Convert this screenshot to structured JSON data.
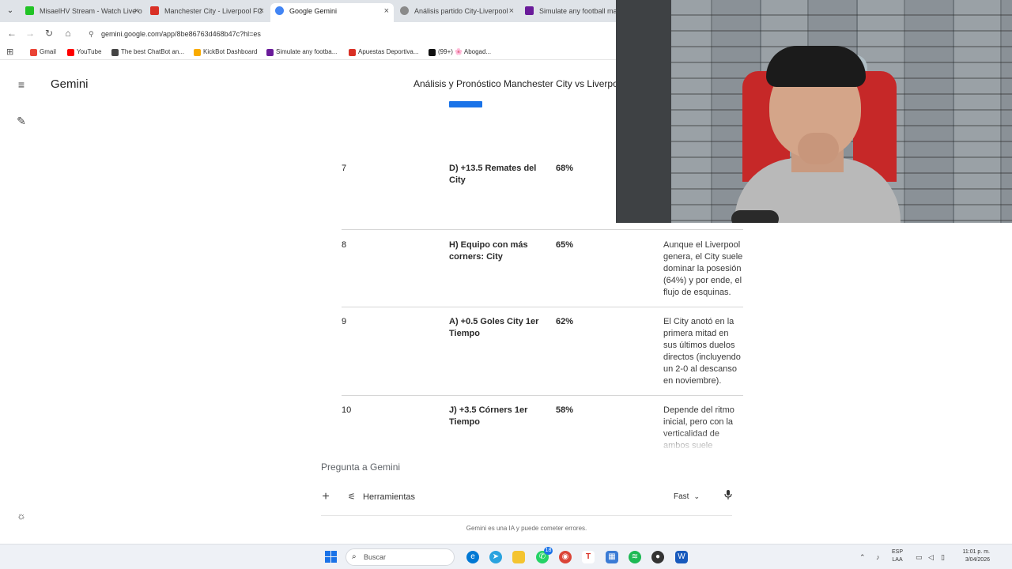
{
  "browser": {
    "tabs": [
      {
        "label": "MisaelHV Stream - Watch Live o",
        "color": "#21c325",
        "active": false
      },
      {
        "label": "Manchester City - Liverpool FC",
        "color": "#d93025",
        "active": false
      },
      {
        "label": "Google Gemini",
        "color": "#4285f4",
        "active": true
      },
      {
        "label": "Análisis partido City-Liverpool",
        "color": "#8a8a8a",
        "active": false
      },
      {
        "label": "Simulate any football match",
        "color": "#6a1b9a",
        "active": false
      }
    ],
    "url": "gemini.google.com/app/8be86763d468b47c?hl=es",
    "bookmarks": [
      {
        "label": "Gmail",
        "color": "#ea4335"
      },
      {
        "label": "YouTube",
        "color": "#ff0000"
      },
      {
        "label": "The best ChatBot an...",
        "color": "#444444"
      },
      {
        "label": "KickBot Dashboard",
        "color": "#f9ab00"
      },
      {
        "label": "Simulate any footba...",
        "color": "#6a1b9a"
      },
      {
        "label": "Apuestas Deportiva...",
        "color": "#d93025"
      },
      {
        "label": "(99+) 🌸 Abogad...",
        "color": "#111111"
      }
    ]
  },
  "gemini": {
    "brand": "Gemini",
    "chat_title": "Análisis y Pronóstico Manchester City vs Liverpool"
  },
  "table": {
    "rows": [
      {
        "num": "7",
        "pick": "D) +13.5 Remates del City",
        "pct": "68%",
        "note": ""
      },
      {
        "num": "8",
        "pick": "H) Equipo con más corners: City",
        "pct": "65%",
        "note": "Aunque el Liverpool genera, el City suele dominar la posesión (64%) y por ende, el flujo de esquinas."
      },
      {
        "num": "9",
        "pick": "A) +0.5 Goles City 1er Tiempo",
        "pct": "62%",
        "note": "El City anotó en la primera mitad en sus últimos duelos directos (incluyendo un 2-0 al descanso en noviembre)."
      },
      {
        "num": "10",
        "pick": "J) +3.5 Córners 1er Tiempo",
        "pct": "58%",
        "note": "Depende del ritmo inicial, pero con la verticalidad de ambos suele cumplirse."
      }
    ]
  },
  "input": {
    "placeholder": "Pregunta a Gemini",
    "tools_label": "Herramientas",
    "mode_label": "Fast",
    "disclaimer": "Gemini es una IA y puede cometer errores."
  },
  "taskbar": {
    "search_label": "Buscar",
    "whatsapp_badge": "18",
    "lang_top": "ESP",
    "lang_bottom": "LAA",
    "time": "11:01 p. m.",
    "date": "3/04/2026"
  },
  "colors": {
    "accent": "#1a73e8",
    "chair": "#c62828"
  }
}
